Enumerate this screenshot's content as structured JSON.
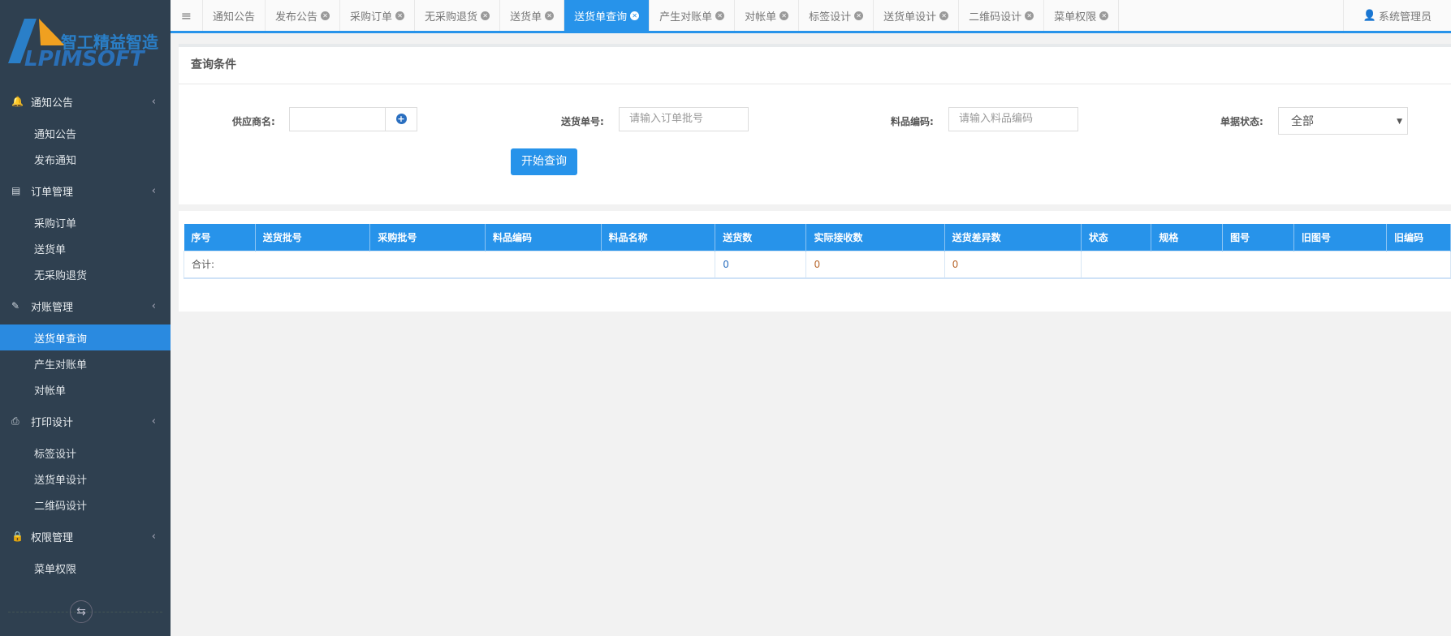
{
  "logo": {
    "cn": "智工精益智造",
    "en": "LPIMSOFT"
  },
  "sidebar": [
    {
      "label": "通知公告",
      "icon": "bell-icon",
      "items": [
        "通知公告",
        "发布通知"
      ]
    },
    {
      "label": "订单管理",
      "icon": "file-icon",
      "items": [
        "采购订单",
        "送货单",
        "无采购退货"
      ]
    },
    {
      "label": "对账管理",
      "icon": "edit-icon",
      "items": [
        "送货单查询",
        "产生对账单",
        "对帐单"
      ]
    },
    {
      "label": "打印设计",
      "icon": "print-icon",
      "items": [
        "标签设计",
        "送货单设计",
        "二维码设计"
      ]
    },
    {
      "label": "权限管理",
      "icon": "lock-icon",
      "items": [
        "菜单权限"
      ]
    }
  ],
  "tabs": [
    "通知公告",
    "发布公告",
    "采购订单",
    "无采购退货",
    "送货单",
    "送货单查询",
    "产生对账单",
    "对帐单",
    "标签设计",
    "送货单设计",
    "二维码设计",
    "菜单权限"
  ],
  "active_tab": "送货单查询",
  "user": "系统管理员",
  "query": {
    "title": "查询条件",
    "supplier_label": "供应商名:",
    "supplier_value": "",
    "delivery_label": "送货单号:",
    "delivery_placeholder": "请输入订单批号",
    "item_label": "料品编码:",
    "item_placeholder": "请输入料品编码",
    "status_label": "单据状态:",
    "status_value": "全部",
    "search_button": "开始查询"
  },
  "table": {
    "headers": [
      "序号",
      "送货批号",
      "采购批号",
      "料品编码",
      "料品名称",
      "送货数",
      "实际接收数",
      "送货差异数",
      "状态",
      "规格",
      "图号",
      "旧图号",
      "旧编码"
    ],
    "total_label": "合计:",
    "total_delivered": "0",
    "total_received": "0",
    "total_diff": "0"
  }
}
